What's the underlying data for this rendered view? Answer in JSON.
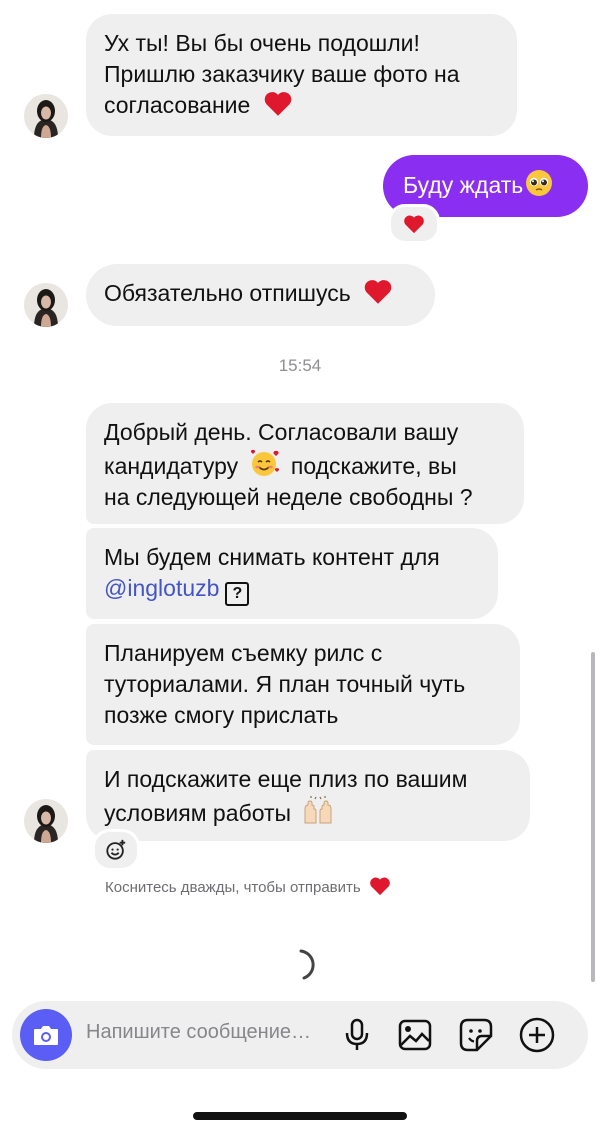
{
  "messages": [
    {
      "direction": "incoming",
      "lines": [
        "Ух ты! Вы бы очень подошли!",
        "Пришлю заказчику ваше фото на",
        "согласование"
      ],
      "trailing_emoji": "red-heart-emoji"
    },
    {
      "direction": "outgoing",
      "text": "Буду ждать",
      "trailing_emoji": "pleading-face-emoji",
      "reaction": "red-heart-emoji"
    },
    {
      "direction": "incoming",
      "text": "Обязательно отпишусь",
      "trailing_emoji": "red-heart-emoji"
    },
    {
      "direction": "incoming",
      "line1": "Добрый день. Согласовали вашу",
      "line2_before": "кандидатуру",
      "line2_emoji": "smiling-face-with-hearts-emoji",
      "line2_after": "подскажите, вы",
      "line3": "на следующей неделе свободны ?"
    },
    {
      "direction": "incoming",
      "line1": "Мы будем снимать контент для",
      "mention": "@inglotuzb",
      "mention_badge": "?"
    },
    {
      "direction": "incoming",
      "lines": [
        "Планируем съемку рилс с",
        "туториалами. Я план точный чуть",
        "позже смогу прислать"
      ]
    },
    {
      "direction": "incoming",
      "lines": [
        "И подскажите еще плиз по вашим",
        "условиям работы"
      ],
      "trailing_emoji": "raising-hands-emoji"
    }
  ],
  "timestamp": "15:54",
  "double_tap_hint": "Коснитесь дважды, чтобы отправить",
  "double_tap_emoji": "red-heart-emoji",
  "composer": {
    "placeholder": "Напишите сообщение…",
    "icons": [
      "camera-icon",
      "microphone-icon",
      "gallery-icon",
      "sticker-icon",
      "add-icon"
    ]
  },
  "colors": {
    "outgoing_bubble": "#8a2ef2",
    "incoming_bubble": "#efeff0",
    "mention": "#4355c4",
    "camera_button": "#5b5ef5",
    "heart": "#e0182d"
  }
}
